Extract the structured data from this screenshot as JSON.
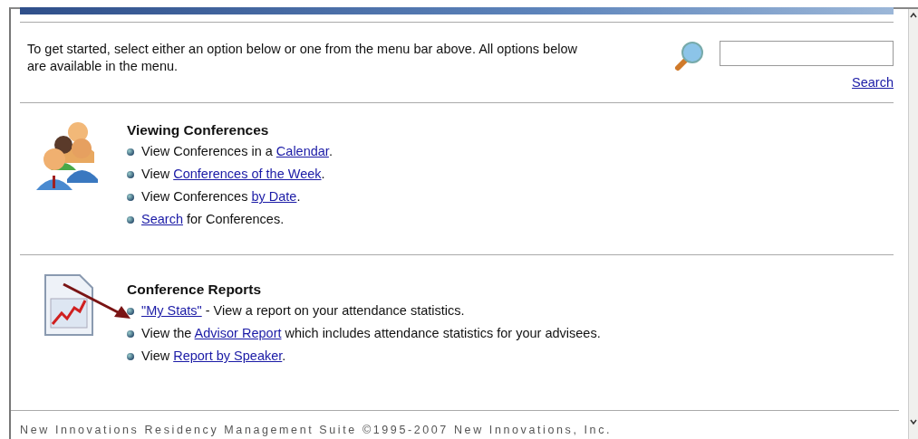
{
  "intro": "To get started, select either an option below or one from the menu bar above. All options below are available in the menu.",
  "search": {
    "link": "Search"
  },
  "sections": [
    {
      "title": "Viewing Conferences",
      "kind": "people",
      "items": [
        [
          {
            "kind": "text",
            "text": "View Conferences in a "
          },
          {
            "kind": "link",
            "text": "Calendar"
          },
          {
            "kind": "text",
            "text": "."
          }
        ],
        [
          {
            "kind": "text",
            "text": "View "
          },
          {
            "kind": "link",
            "text": "Conferences of the Week"
          },
          {
            "kind": "text",
            "text": "."
          }
        ],
        [
          {
            "kind": "text",
            "text": "View Conferences "
          },
          {
            "kind": "link",
            "text": "by Date"
          },
          {
            "kind": "text",
            "text": "."
          }
        ],
        [
          {
            "kind": "link",
            "text": "Search"
          },
          {
            "kind": "text",
            "text": " for Conferences."
          }
        ]
      ]
    },
    {
      "title": "Conference Reports",
      "kind": "report",
      "items": [
        [
          {
            "kind": "link",
            "text": "\"My Stats\""
          },
          {
            "kind": "text",
            "text": " - View a report on your attendance statistics."
          }
        ],
        [
          {
            "kind": "text",
            "text": "View the "
          },
          {
            "kind": "link",
            "text": "Advisor Report"
          },
          {
            "kind": "text",
            "text": " which includes attendance statistics for your advisees."
          }
        ],
        [
          {
            "kind": "text",
            "text": "View "
          },
          {
            "kind": "link",
            "text": "Report by Speaker"
          },
          {
            "kind": "text",
            "text": "."
          }
        ]
      ]
    }
  ],
  "footer": "New Innovations Residency Management Suite ©1995-2007 New Innovations, Inc."
}
